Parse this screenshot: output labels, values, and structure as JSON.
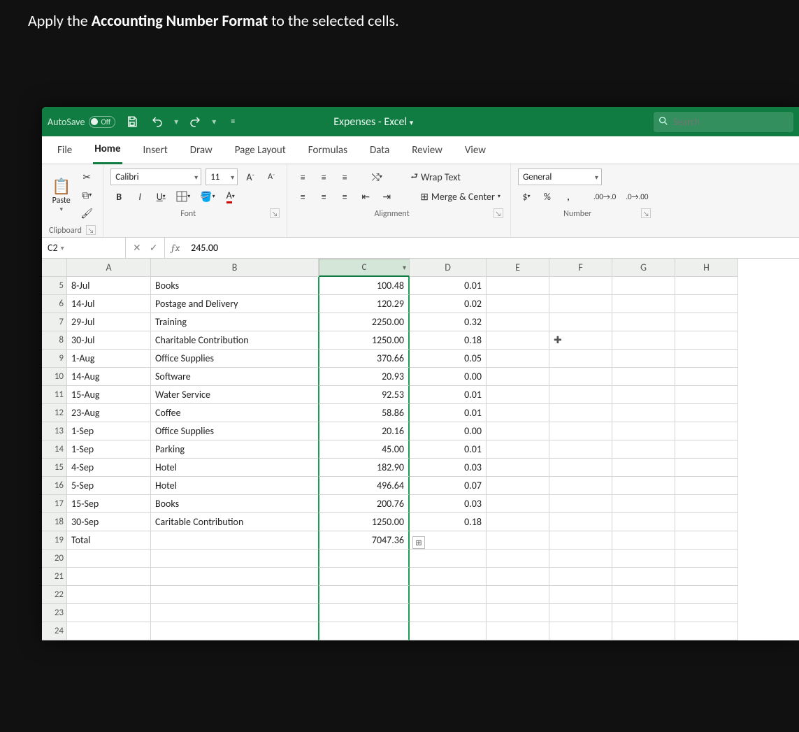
{
  "instruction": {
    "pre": "Apply the ",
    "bold": "Accounting Number Format",
    "post": " to the selected cells."
  },
  "title": {
    "autosave": "AutoSave",
    "autosave_state": "Off",
    "doc": "Expenses - Excel",
    "search_ph": "Search"
  },
  "tabs": [
    "File",
    "Home",
    "Insert",
    "Draw",
    "Page Layout",
    "Formulas",
    "Data",
    "Review",
    "View"
  ],
  "active_tab": 1,
  "ribbon": {
    "clipboard": {
      "label": "Clipboard",
      "paste": "Paste"
    },
    "font": {
      "label": "Font",
      "name": "Calibri",
      "size": "11",
      "bold": "B",
      "italic": "I",
      "underline": "U"
    },
    "align": {
      "label": "Alignment",
      "wrap": "Wrap Text",
      "merge": "Merge & Center"
    },
    "number": {
      "label": "Number",
      "format": "General",
      "dollar": "$",
      "percent": "%",
      "comma": ","
    }
  },
  "fbar": {
    "ref": "C2",
    "value": "245.00"
  },
  "cols": [
    "A",
    "B",
    "C",
    "D",
    "E",
    "F",
    "G",
    "H"
  ],
  "selected_col": 2,
  "rows": [
    {
      "n": 5,
      "a": "8-Jul",
      "b": "Books",
      "c": "100.48",
      "d": "0.01"
    },
    {
      "n": 6,
      "a": "14-Jul",
      "b": "Postage and Delivery",
      "c": "120.29",
      "d": "0.02"
    },
    {
      "n": 7,
      "a": "29-Jul",
      "b": "Training",
      "c": "2250.00",
      "d": "0.32"
    },
    {
      "n": 8,
      "a": "30-Jul",
      "b": "Charitable Contribution",
      "c": "1250.00",
      "d": "0.18"
    },
    {
      "n": 9,
      "a": "1-Aug",
      "b": "Office Supplies",
      "c": "370.66",
      "d": "0.05"
    },
    {
      "n": 10,
      "a": "14-Aug",
      "b": "Software",
      "c": "20.93",
      "d": "0.00"
    },
    {
      "n": 11,
      "a": "15-Aug",
      "b": "Water Service",
      "c": "92.53",
      "d": "0.01"
    },
    {
      "n": 12,
      "a": "23-Aug",
      "b": "Coffee",
      "c": "58.86",
      "d": "0.01"
    },
    {
      "n": 13,
      "a": "1-Sep",
      "b": "Office Supplies",
      "c": "20.16",
      "d": "0.00"
    },
    {
      "n": 14,
      "a": "1-Sep",
      "b": "Parking",
      "c": "45.00",
      "d": "0.01"
    },
    {
      "n": 15,
      "a": "4-Sep",
      "b": "Hotel",
      "c": "182.90",
      "d": "0.03"
    },
    {
      "n": 16,
      "a": "5-Sep",
      "b": "Hotel",
      "c": "496.64",
      "d": "0.07"
    },
    {
      "n": 17,
      "a": "15-Sep",
      "b": "Books",
      "c": "200.76",
      "d": "0.03"
    },
    {
      "n": 18,
      "a": "30-Sep",
      "b": "Caritable Contribution",
      "c": "1250.00",
      "d": "0.18"
    },
    {
      "n": 19,
      "a": "Total",
      "b": "",
      "c": "7047.36",
      "d": ""
    },
    {
      "n": 20,
      "a": "",
      "b": "",
      "c": "",
      "d": ""
    },
    {
      "n": 21,
      "a": "",
      "b": "",
      "c": "",
      "d": ""
    },
    {
      "n": 22,
      "a": "",
      "b": "",
      "c": "",
      "d": ""
    },
    {
      "n": 23,
      "a": "",
      "b": "",
      "c": "",
      "d": ""
    },
    {
      "n": 24,
      "a": "",
      "b": "",
      "c": "",
      "d": ""
    }
  ],
  "cursor_row_index": 3,
  "quick_options_row_index": 14
}
